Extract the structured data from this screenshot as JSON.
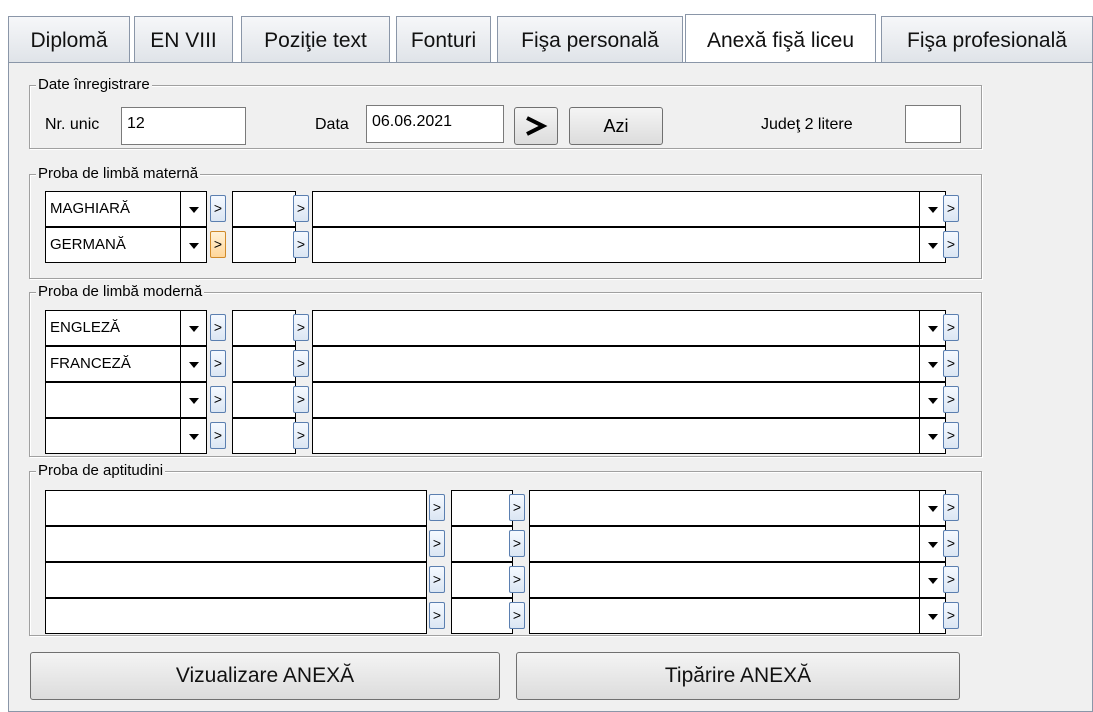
{
  "tabs": [
    {
      "label": "Diplomă",
      "active": false
    },
    {
      "label": "EN VIII",
      "active": false
    },
    {
      "label": "Poziţie text",
      "active": false
    },
    {
      "label": "Fonturi",
      "active": false
    },
    {
      "label": "Fişa personală",
      "active": false
    },
    {
      "label": "Anexă fişă liceu",
      "active": true
    },
    {
      "label": "Fişa profesională",
      "active": false
    }
  ],
  "registration": {
    "group_title": "Date înregistrare",
    "nr_unic_label": "Nr. unic",
    "nr_unic_value": "12",
    "data_label": "Data",
    "data_value": "06.06.2021",
    "go_button": ">",
    "today_button": "Azi",
    "judet_label": "Judeţ 2 litere",
    "judet_value": ""
  },
  "maternal_language": {
    "group_title": "Proba de limbă maternă",
    "small_button_label": ">",
    "rows": [
      {
        "language": "MAGHIARĂ",
        "grade": "",
        "description": ""
      },
      {
        "language": "GERMANĂ",
        "grade": "",
        "description": ""
      }
    ]
  },
  "modern_language": {
    "group_title": "Proba de limbă modernă",
    "small_button_label": ">",
    "rows": [
      {
        "language": "ENGLEZĂ",
        "grade": "",
        "description": ""
      },
      {
        "language": "FRANCEZĂ",
        "grade": "",
        "description": ""
      },
      {
        "language": "",
        "grade": "",
        "description": ""
      },
      {
        "language": "",
        "grade": "",
        "description": ""
      }
    ]
  },
  "aptitude": {
    "group_title": "Proba de aptitudini",
    "small_button_label": ">",
    "rows": [
      {
        "name": "",
        "grade": "",
        "description": ""
      },
      {
        "name": "",
        "grade": "",
        "description": ""
      },
      {
        "name": "",
        "grade": "",
        "description": ""
      },
      {
        "name": "",
        "grade": "",
        "description": ""
      }
    ]
  },
  "actions": {
    "preview_label": "Vizualizare ANEXĂ",
    "print_label": "Tipărire ANEXĂ"
  },
  "icons": {
    "go_arrow": "right-arrow-icon",
    "dropdown": "chevron-down-icon",
    "small_button": "right-arrow-icon"
  }
}
